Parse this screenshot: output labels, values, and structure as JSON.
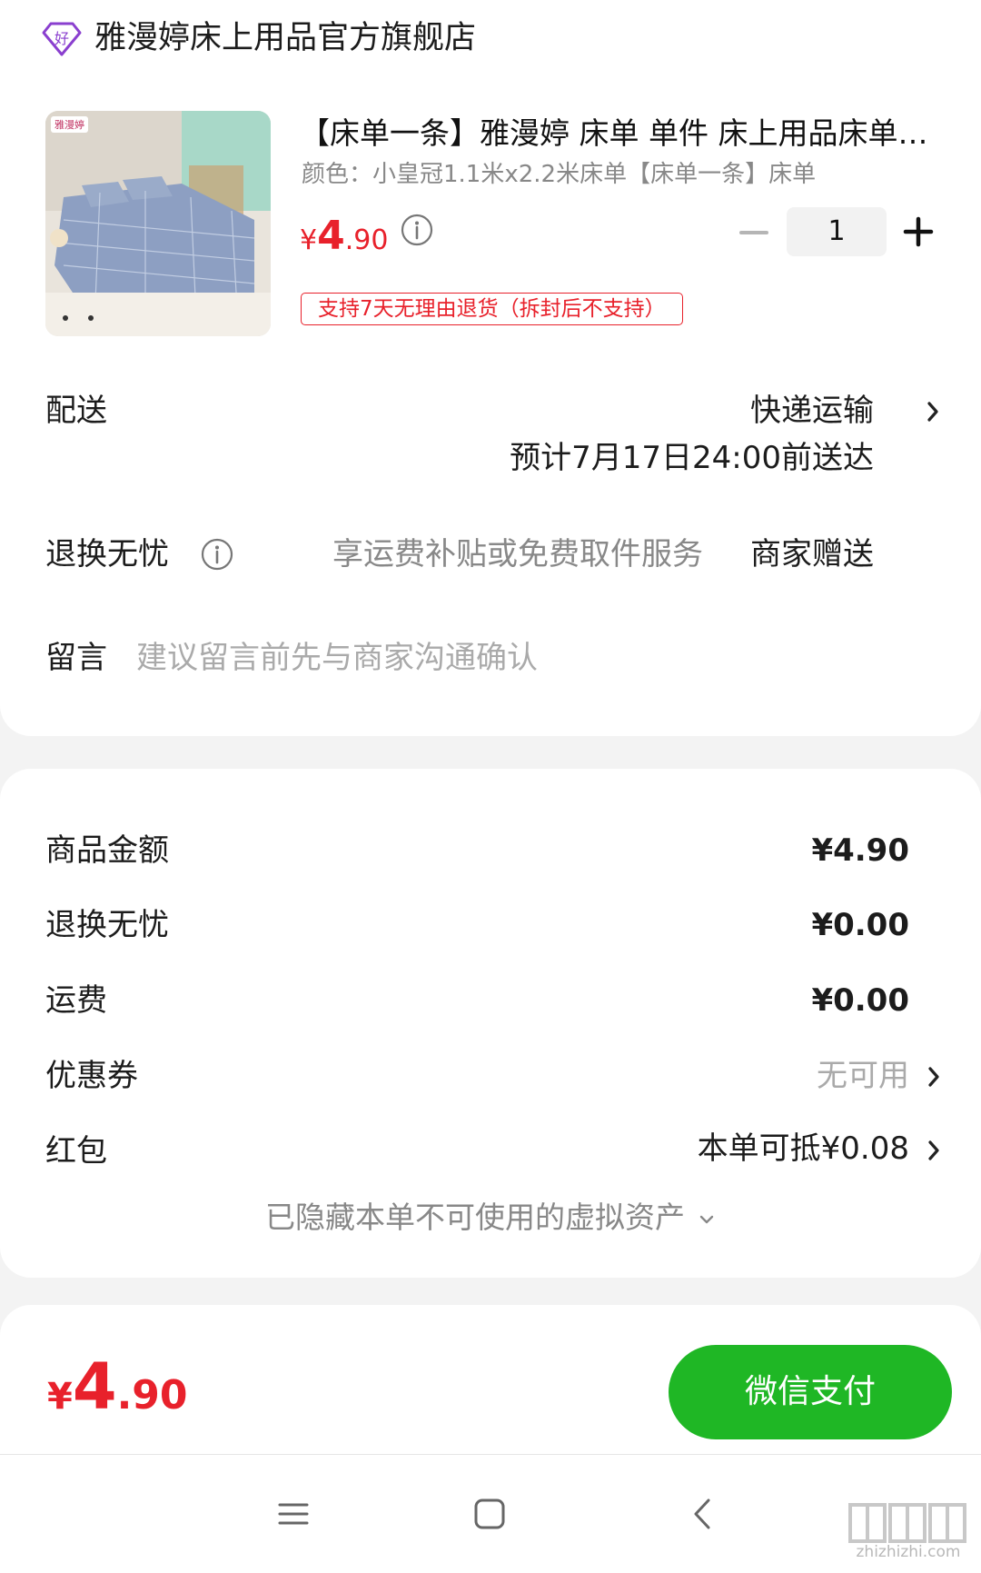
{
  "store": {
    "name": "雅漫婷床上用品官方旗舰店",
    "icon": "diamond-hao-icon"
  },
  "product": {
    "title": "【床单一条】雅漫婷 床单 单件 床上用品床单单人双人宿舍家用被单",
    "spec": "颜色：小皇冠1.1米x2.2米床单【床单一条】床单",
    "thumb_brand": "雅漫婷",
    "price": {
      "yen": "¥",
      "int": "4",
      "dec": ".90"
    },
    "quantity": "1",
    "return_tag": "支持7天无理由退货（拆封后不支持）"
  },
  "delivery": {
    "label": "配送",
    "method": "快递运输",
    "eta": "预计7月17日24:00前送达"
  },
  "worry_free": {
    "label": "退换无忧",
    "desc": "享运费补贴或免费取件服务",
    "gift": "商家赠送"
  },
  "message": {
    "label": "留言",
    "placeholder": "建议留言前先与商家沟通确认"
  },
  "amounts": [
    {
      "label": "商品金额",
      "value": "¥4.90"
    },
    {
      "label": "退换无忧",
      "value": "¥0.00"
    },
    {
      "label": "运费",
      "value": "¥0.00"
    },
    {
      "label": "优惠券",
      "value": "无可用"
    },
    {
      "label": "红包",
      "value": "本单可抵¥0.08"
    }
  ],
  "hidden_assets": "已隐藏本单不可使用的虚拟资产",
  "total": {
    "yen": "¥",
    "int": "4",
    "dec": ".90"
  },
  "pay_button": "微信支付",
  "watermark": "zhizhizhi.com",
  "colors": {
    "price_red": "#e8212b",
    "pay_green": "#1fb725",
    "store_icon_purple": "#8a3fcf"
  }
}
